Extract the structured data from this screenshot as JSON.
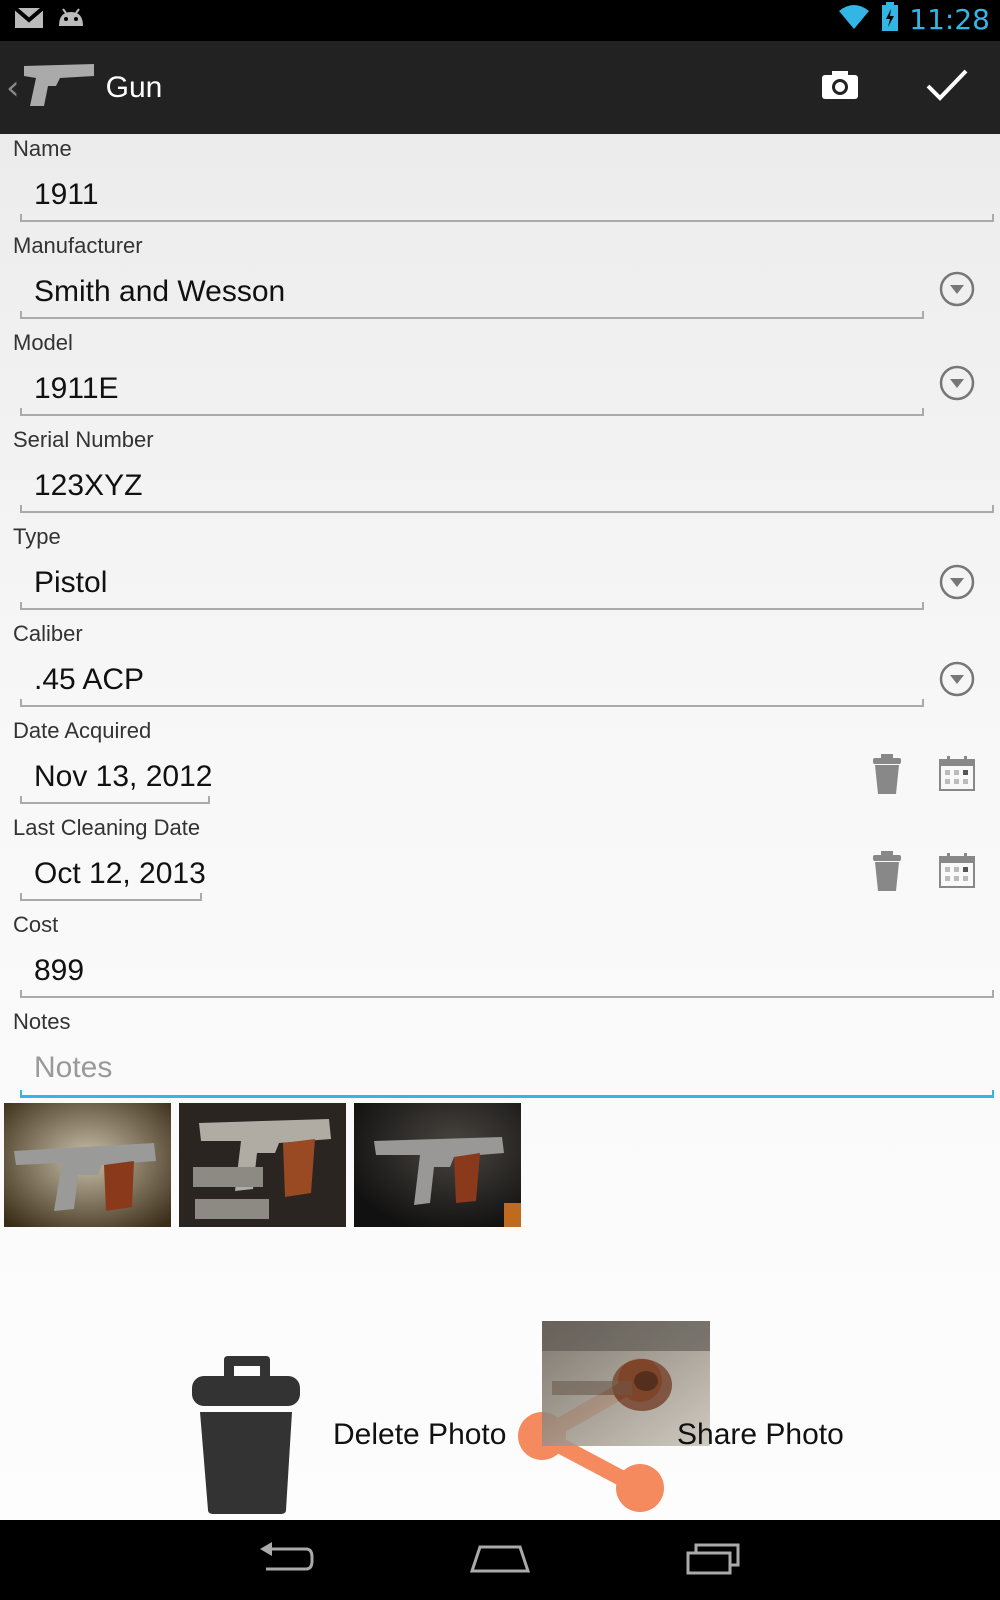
{
  "status_bar": {
    "time": "11:28",
    "icons": [
      "gmail-icon",
      "android-icon",
      "wifi-icon",
      "battery-charging-icon"
    ]
  },
  "action_bar": {
    "title": "Gun",
    "app_icon": "pistol-icon",
    "actions": [
      "camera-icon",
      "checkmark-icon"
    ]
  },
  "form": {
    "name": {
      "label": "Name",
      "value": "1911"
    },
    "manufacturer": {
      "label": "Manufacturer",
      "value": "Smith and Wesson"
    },
    "model": {
      "label": "Model",
      "value": "1911E"
    },
    "serial": {
      "label": "Serial Number",
      "value": "123XYZ"
    },
    "type": {
      "label": "Type",
      "value": "Pistol"
    },
    "caliber": {
      "label": "Caliber",
      "value": ".45 ACP"
    },
    "date_acquired": {
      "label": "Date Acquired",
      "value": "Nov 13, 2012"
    },
    "last_cleaning": {
      "label": "Last Cleaning Date",
      "value": "Oct 12, 2013"
    },
    "cost": {
      "label": "Cost",
      "value": "899"
    },
    "notes": {
      "label": "Notes",
      "placeholder": "Notes",
      "value": ""
    }
  },
  "photos": [
    "pistol-photo-1",
    "pistol-photo-2-with-magazines",
    "pistol-photo-3"
  ],
  "drag_actions": {
    "delete_label": "Delete Photo",
    "share_label": "Share Photo"
  },
  "nav_bar": [
    "back-icon",
    "home-icon",
    "recent-apps-icon"
  ],
  "colors": {
    "accent": "#33b5e5",
    "share_orange": "#f58a5e",
    "action_bar": "#222222"
  }
}
